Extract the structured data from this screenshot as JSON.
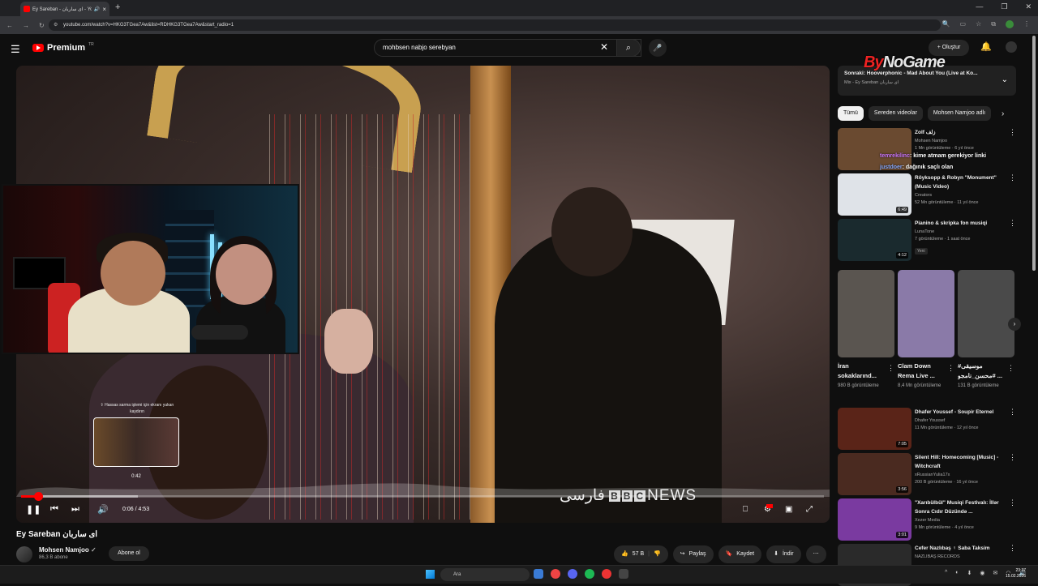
{
  "browser": {
    "tab_title": "Ey Sareban - ای ساربان - You",
    "url": "youtube.com/watch?v=HKG3TGea7Aw&list=RDHKG3TGea7Aw&start_radio=1"
  },
  "header": {
    "logo_text": "Premium",
    "region": "TR",
    "search_value": "mohbsen nabjo serebyan",
    "create_label": "Oluştur"
  },
  "player": {
    "hint_text": "⇧ Hassas sarma işlemi için ekranı yukarı kaydırın",
    "preview_time": "0:42",
    "time_display": "0:06 / 4:53",
    "progress_fraction": 0.021,
    "buffer_fraction": 0.145,
    "hover_fraction": 0.145,
    "overlay_brand": "فارسی",
    "overlay_brand2": "NEWS",
    "bbc_letters": [
      "B",
      "B",
      "C"
    ]
  },
  "video": {
    "title": "Ey Sareban ای ساربان",
    "channel": "Mohsen Namjoo",
    "subs": "86,3 B abone",
    "subscribe_label": "Abone ol",
    "likes": "57 B",
    "share_label": "Paylaş",
    "save_label": "Kaydet",
    "download_label": "İndir"
  },
  "watermark": {
    "brand1": "By",
    "brand2": "NoGame"
  },
  "sidebar": {
    "next_up_title": "Sonraki: Hooverphonic - Mad About You (Live at Ko...",
    "next_up_sub": "Mix - Ey Sareban ای ساربان",
    "chips": [
      "Tümü",
      "Sereden videolar",
      "Mohsen Namjoo adlı"
    ],
    "chat": [
      {
        "user": "temrekilinc",
        "msg": ": kime atmam gerekiyor linki"
      },
      {
        "user": "justdoer",
        "msg": ": dağınık saçlı olan"
      }
    ],
    "recs": [
      {
        "title": "Zolf زلف",
        "channel": "Mohsen Namjoo",
        "meta": "1 Mn görüntüleme · 6 yıl önce",
        "duration": "",
        "color": "#6a4a30"
      },
      {
        "title": "Röyksopp & Robyn \"Monument\" (Music Video)",
        "channel": "Creators",
        "meta": "52 Mn görüntüleme · 11 yıl önce",
        "duration": "6:49",
        "color": "#dfe3e8"
      },
      {
        "title": "Pianino & skripka fon musiqi",
        "channel": "LunaTone",
        "meta": "7 görüntüleme · 1 saat önce",
        "duration": "4:12",
        "color": "#1a2a2e",
        "badge": "Yeni"
      },
      {
        "title": "Dhafer Youssef - Soupir Eternel",
        "channel": "Dhafer Youssef",
        "meta": "11 Mn görüntüleme · 12 yıl önce",
        "duration": "7:05",
        "color": "#5a2418"
      },
      {
        "title": "Silent Hill: Homecoming [Music] - Witchcraft",
        "channel": "xRussianYulia17x",
        "meta": "200 B görüntüleme · 16 yıl önce",
        "duration": "3:56",
        "color": "#4a2a20"
      },
      {
        "title": "\"Xarıbülbül\" Musiqi Festivalı: İllər Sonra Cıdır Düzündə ...",
        "channel": "Xezer Media",
        "meta": "9 Mn görüntüleme · 4 yıl önce",
        "duration": "3:01",
        "color": "#7a3aa0"
      },
      {
        "title": "Cefer Nazlıbaş ♀ Saba Taksim",
        "channel": "NAZLIBAŞ RECORDS",
        "meta": "",
        "duration": "",
        "color": "#2a2a2a"
      }
    ],
    "shorts": [
      {
        "title": "İran sokaklarınd...",
        "views": "980 B görüntüleme",
        "color": "#5a5550"
      },
      {
        "title": "Clam Down Rema Live ...",
        "views": "8,4 Mn görüntüleme",
        "color": "#8a7aa8"
      },
      {
        "title": "موسیقی# محسن_نامجو# ...",
        "views": "131 B görüntüleme",
        "color": "#4a4a4a"
      }
    ]
  },
  "taskbar": {
    "search_label": "Ara",
    "time": "23:37",
    "date": "15.02.2026"
  }
}
